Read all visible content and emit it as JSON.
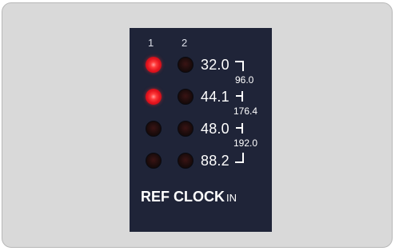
{
  "panel": {
    "columns": [
      "1",
      "2"
    ],
    "rows": [
      {
        "rate": "32.0",
        "led1": "on",
        "led2": "off"
      },
      {
        "rate": "44.1",
        "led1": "on",
        "led2": "off"
      },
      {
        "rate": "48.0",
        "led1": "off",
        "led2": "off"
      },
      {
        "rate": "88.2",
        "led1": "off",
        "led2": "off"
      }
    ],
    "sub_rates": [
      "96.0",
      "176.4",
      "192.0"
    ],
    "title": "REF CLOCK",
    "title_suffix": "IN",
    "colors": {
      "panel_bg": "#1f2438",
      "led_on": "#e3131e",
      "led_off": "#1c0c0c",
      "text": "#ffffff"
    }
  }
}
